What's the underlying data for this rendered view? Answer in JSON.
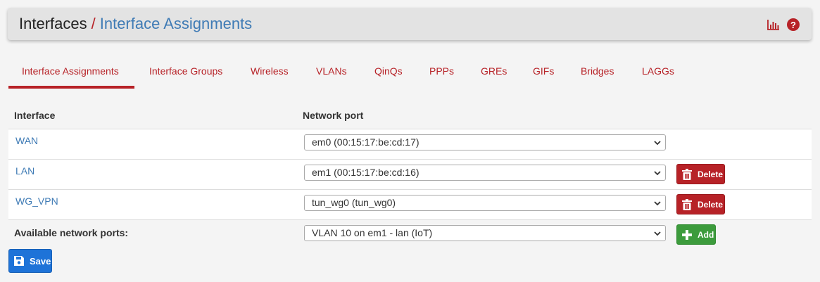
{
  "header": {
    "section": "Interfaces",
    "separator": "/",
    "page": "Interface Assignments",
    "icons": [
      "bar-chart-icon",
      "help-icon"
    ]
  },
  "tabs": [
    {
      "label": "Interface Assignments",
      "active": true
    },
    {
      "label": "Interface Groups",
      "active": false
    },
    {
      "label": "Wireless",
      "active": false
    },
    {
      "label": "VLANs",
      "active": false
    },
    {
      "label": "QinQs",
      "active": false
    },
    {
      "label": "PPPs",
      "active": false
    },
    {
      "label": "GREs",
      "active": false
    },
    {
      "label": "GIFs",
      "active": false
    },
    {
      "label": "Bridges",
      "active": false
    },
    {
      "label": "LAGGs",
      "active": false
    }
  ],
  "table": {
    "columns": [
      "Interface",
      "Network port"
    ],
    "rows": [
      {
        "interface": "WAN",
        "port": "em0 (00:15:17:be:cd:17)",
        "delete_label": ""
      },
      {
        "interface": "LAN",
        "port": "em1 (00:15:17:be:cd:16)",
        "delete_label": "Delete"
      },
      {
        "interface": "WG_VPN",
        "port": "tun_wg0 (tun_wg0)",
        "delete_label": "Delete"
      }
    ],
    "available": {
      "label": "Available network ports:",
      "port": "VLAN 10 on em1 - lan (IoT)",
      "add_label": "Add"
    }
  },
  "save_label": "Save",
  "colors": {
    "accent_red": "#b72227",
    "link_blue": "#3f7bb5",
    "add_green": "#3c9b3c",
    "save_blue": "#1e73d8"
  }
}
